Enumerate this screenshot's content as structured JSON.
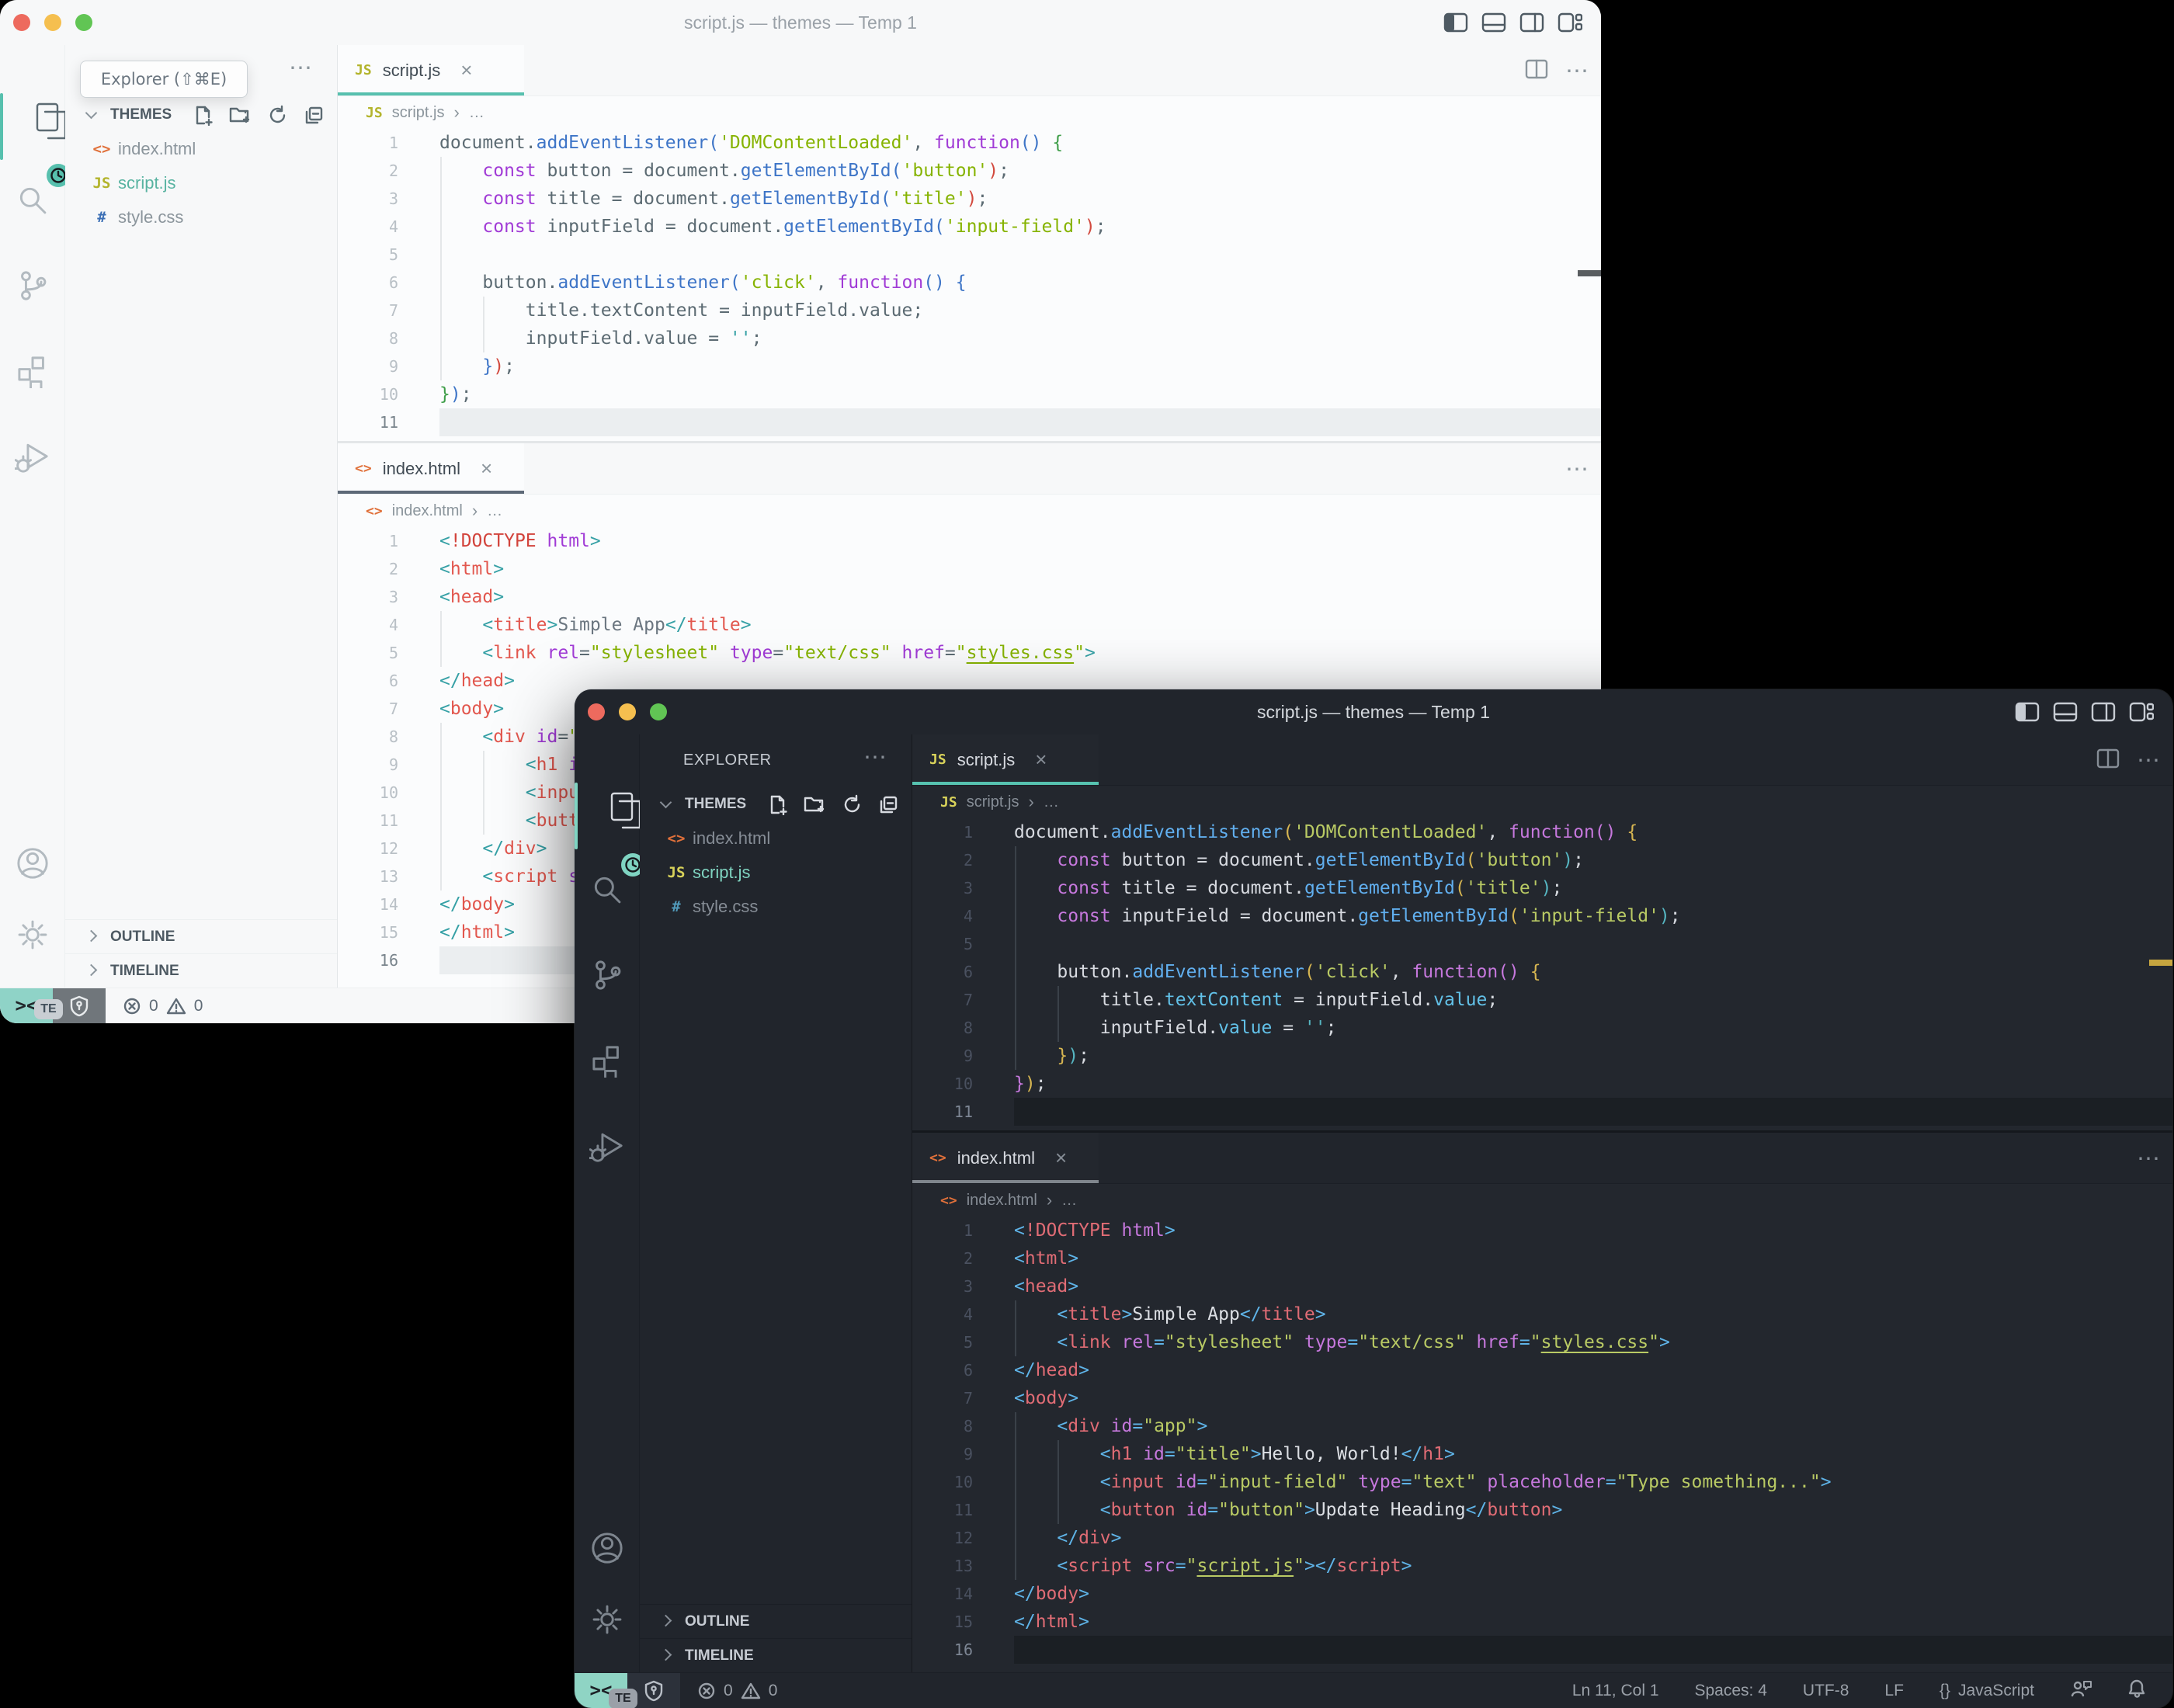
{
  "title": "script.js — themes — Temp 1",
  "tooltip": {
    "text": "Explorer (⇧⌘E)"
  },
  "sidebar": {
    "explorer": "EXPLORER",
    "section": "THEMES",
    "more": "⋯"
  },
  "files": [
    {
      "name": "index.html",
      "type": "html"
    },
    {
      "name": "script.js",
      "type": "js",
      "active": true
    },
    {
      "name": "style.css",
      "type": "css"
    }
  ],
  "tabs": {
    "script": "script.js",
    "html": "index.html",
    "close": "×"
  },
  "crumbs": {
    "script": "script.js",
    "html": "index.html",
    "sep": "›",
    "more": "…"
  },
  "panels": {
    "outline": "OUTLINE",
    "timeline": "TIMELINE"
  },
  "status": {
    "remote": "><",
    "errors": "0",
    "warnings": "0",
    "badge": "TE",
    "ln": "Ln 11, Col 1",
    "spaces": "Spaces: 4",
    "enc": "UTF-8",
    "eol": "LF",
    "braces": "{}",
    "lang": "JavaScript"
  },
  "accents": {
    "teal": "#56c2b0",
    "traffic_red": "#ed6a5e",
    "traffic_yellow": "#f5bf4f",
    "traffic_green": "#61c554",
    "ruler_gold": "#c6a53f",
    "html_icon": "#e0703a"
  },
  "code": {
    "script_js": [
      {
        "n": 1,
        "s": [
          [
            "document",
            "fg"
          ],
          [
            ".",
            "fg"
          ],
          [
            "addEventListener",
            "fn"
          ],
          [
            "(",
            "pr1"
          ],
          [
            "'DOMContentLoaded'",
            "str"
          ],
          [
            ", ",
            "fg"
          ],
          [
            "function",
            "kw"
          ],
          [
            "()",
            "pr2"
          ],
          [
            " ",
            "fg"
          ],
          [
            "{",
            "pr3"
          ]
        ]
      },
      {
        "n": 2,
        "s": [
          [
            "    ",
            "fg"
          ],
          [
            "const",
            "kw"
          ],
          [
            " button ",
            "fg"
          ],
          [
            "=",
            "fg"
          ],
          [
            " ",
            "fg"
          ],
          [
            "document",
            "fg"
          ],
          [
            ".",
            "fg"
          ],
          [
            "getElementById",
            "fn"
          ],
          [
            "(",
            "pr4"
          ],
          [
            "'button'",
            "str"
          ],
          [
            ")",
            "pr5"
          ],
          [
            ";",
            "fg"
          ]
        ]
      },
      {
        "n": 3,
        "s": [
          [
            "    ",
            "fg"
          ],
          [
            "const",
            "kw"
          ],
          [
            " title ",
            "fg"
          ],
          [
            "=",
            "fg"
          ],
          [
            " ",
            "fg"
          ],
          [
            "document",
            "fg"
          ],
          [
            ".",
            "fg"
          ],
          [
            "getElementById",
            "fn"
          ],
          [
            "(",
            "pr4"
          ],
          [
            "'title'",
            "str"
          ],
          [
            ")",
            "pr5"
          ],
          [
            ";",
            "fg"
          ]
        ]
      },
      {
        "n": 4,
        "s": [
          [
            "    ",
            "fg"
          ],
          [
            "const",
            "kw"
          ],
          [
            " inputField ",
            "fg"
          ],
          [
            "=",
            "fg"
          ],
          [
            " ",
            "fg"
          ],
          [
            "document",
            "fg"
          ],
          [
            ".",
            "fg"
          ],
          [
            "getElementById",
            "fn"
          ],
          [
            "(",
            "pr4"
          ],
          [
            "'input-field'",
            "str"
          ],
          [
            ")",
            "pr5"
          ],
          [
            ";",
            "fg"
          ]
        ]
      },
      {
        "n": 5,
        "s": [],
        "g": 1
      },
      {
        "n": 6,
        "s": [
          [
            "    ",
            "fg"
          ],
          [
            "button",
            "fg"
          ],
          [
            ".",
            "fg"
          ],
          [
            "addEventListener",
            "fn"
          ],
          [
            "(",
            "pr4"
          ],
          [
            "'click'",
            "str"
          ],
          [
            ", ",
            "fg"
          ],
          [
            "function",
            "kw"
          ],
          [
            "()",
            "pr2"
          ],
          [
            " ",
            "fg"
          ],
          [
            "{",
            "pr6"
          ]
        ]
      },
      {
        "n": 7,
        "s": [
          [
            "        ",
            "fg"
          ],
          [
            "title",
            "fg"
          ],
          [
            ".",
            "fg"
          ],
          [
            "textContent",
            "prop"
          ],
          [
            " = ",
            "fg"
          ],
          [
            "inputField",
            "fg"
          ],
          [
            ".",
            "fg"
          ],
          [
            "value",
            "prop"
          ],
          [
            ";",
            "fg"
          ]
        ]
      },
      {
        "n": 8,
        "s": [
          [
            "        ",
            "fg"
          ],
          [
            "inputField",
            "fg"
          ],
          [
            ".",
            "fg"
          ],
          [
            "value",
            "prop"
          ],
          [
            " = ",
            "fg"
          ],
          [
            "''",
            "str2"
          ],
          [
            ";",
            "fg"
          ]
        ]
      },
      {
        "n": 9,
        "s": [
          [
            "    ",
            "fg"
          ],
          [
            "}",
            "pr6"
          ],
          [
            ")",
            "pr7"
          ],
          [
            ";",
            "fg"
          ]
        ]
      },
      {
        "n": 10,
        "s": [
          [
            "}",
            "pr8"
          ],
          [
            ")",
            "pr9"
          ],
          [
            ";",
            "fg"
          ]
        ]
      },
      {
        "n": 11,
        "s": [],
        "hl": true
      }
    ],
    "index_html": [
      {
        "n": 1,
        "s": [
          [
            "<",
            "tp"
          ],
          [
            "!DOCTYPE",
            "doc"
          ],
          [
            " ",
            "fg"
          ],
          [
            "html",
            "kw"
          ],
          [
            ">",
            "tp"
          ]
        ]
      },
      {
        "n": 2,
        "s": [
          [
            "<",
            "tp"
          ],
          [
            "html",
            "tag"
          ],
          [
            ">",
            "tp"
          ]
        ]
      },
      {
        "n": 3,
        "s": [
          [
            "<",
            "tp"
          ],
          [
            "head",
            "tag"
          ],
          [
            ">",
            "tp"
          ]
        ]
      },
      {
        "n": 4,
        "s": [
          [
            "    ",
            "fg"
          ],
          [
            "<",
            "tp"
          ],
          [
            "title",
            "tag"
          ],
          [
            ">",
            "tp"
          ],
          [
            "Simple App",
            "txt"
          ],
          [
            "</",
            "tp"
          ],
          [
            "title",
            "tag"
          ],
          [
            ">",
            "tp"
          ]
        ]
      },
      {
        "n": 5,
        "s": [
          [
            "    ",
            "fg"
          ],
          [
            "<",
            "tp"
          ],
          [
            "link",
            "tag"
          ],
          [
            " ",
            "fg"
          ],
          [
            "rel",
            "attr"
          ],
          [
            "=",
            "eq"
          ],
          [
            "\"stylesheet\"",
            "str"
          ],
          [
            " ",
            "fg"
          ],
          [
            "type",
            "attr"
          ],
          [
            "=",
            "eq"
          ],
          [
            "\"text/css\"",
            "str"
          ],
          [
            " ",
            "fg"
          ],
          [
            "href",
            "attr"
          ],
          [
            "=",
            "eq"
          ],
          [
            "\"",
            "str"
          ],
          [
            "styles.css",
            "strU"
          ],
          [
            "\"",
            "str"
          ],
          [
            ">",
            "tp"
          ]
        ]
      },
      {
        "n": 6,
        "s": [
          [
            "</",
            "tp"
          ],
          [
            "head",
            "tag"
          ],
          [
            ">",
            "tp"
          ]
        ]
      },
      {
        "n": 7,
        "s": [
          [
            "<",
            "tp"
          ],
          [
            "body",
            "tag"
          ],
          [
            ">",
            "tp"
          ]
        ]
      },
      {
        "n": 8,
        "s": [
          [
            "    ",
            "fg"
          ],
          [
            "<",
            "tp"
          ],
          [
            "div",
            "tag"
          ],
          [
            " ",
            "fg"
          ],
          [
            "id",
            "attr"
          ],
          [
            "=",
            "eq"
          ],
          [
            "\"app\"",
            "str"
          ],
          [
            ">",
            "tp"
          ]
        ]
      },
      {
        "n": 9,
        "s": [
          [
            "        ",
            "fg"
          ],
          [
            "<",
            "tp"
          ],
          [
            "h1",
            "tag"
          ],
          [
            " ",
            "fg"
          ],
          [
            "id",
            "attr"
          ],
          [
            "=",
            "eq"
          ],
          [
            "\"title\"",
            "str"
          ],
          [
            ">",
            "tp"
          ],
          [
            "Hello, World!",
            "txt"
          ],
          [
            "</",
            "tp"
          ],
          [
            "h1",
            "tag"
          ],
          [
            ">",
            "tp"
          ]
        ]
      },
      {
        "n": 10,
        "s": [
          [
            "        ",
            "fg"
          ],
          [
            "<",
            "tp"
          ],
          [
            "input",
            "tag"
          ],
          [
            " ",
            "fg"
          ],
          [
            "id",
            "attr"
          ],
          [
            "=",
            "eq"
          ],
          [
            "\"input-field\"",
            "str"
          ],
          [
            " ",
            "fg"
          ],
          [
            "type",
            "attr"
          ],
          [
            "=",
            "eq"
          ],
          [
            "\"text\"",
            "str"
          ],
          [
            " ",
            "fg"
          ],
          [
            "placeholder",
            "attr"
          ],
          [
            "=",
            "eq"
          ],
          [
            "\"Type something...\"",
            "str"
          ],
          [
            ">",
            "tp"
          ]
        ]
      },
      {
        "n": 11,
        "s": [
          [
            "        ",
            "fg"
          ],
          [
            "<",
            "tp"
          ],
          [
            "button",
            "tag"
          ],
          [
            " ",
            "fg"
          ],
          [
            "id",
            "attr"
          ],
          [
            "=",
            "eq"
          ],
          [
            "\"button\"",
            "str"
          ],
          [
            ">",
            "tp"
          ],
          [
            "Update Heading",
            "txt"
          ],
          [
            "</",
            "tp"
          ],
          [
            "button",
            "tag"
          ],
          [
            ">",
            "tp"
          ]
        ]
      },
      {
        "n": 12,
        "s": [
          [
            "    ",
            "fg"
          ],
          [
            "</",
            "tp"
          ],
          [
            "div",
            "tag"
          ],
          [
            ">",
            "tp"
          ]
        ]
      },
      {
        "n": 13,
        "s": [
          [
            "    ",
            "fg"
          ],
          [
            "<",
            "tp"
          ],
          [
            "script",
            "tag"
          ],
          [
            " ",
            "fg"
          ],
          [
            "src",
            "attr"
          ],
          [
            "=",
            "eq"
          ],
          [
            "\"",
            "str"
          ],
          [
            "script.js",
            "strU"
          ],
          [
            "\"",
            "str"
          ],
          [
            ">",
            "tp"
          ],
          [
            "</",
            "tp"
          ],
          [
            "script",
            "tag"
          ],
          [
            ">",
            "tp"
          ]
        ]
      },
      {
        "n": 14,
        "s": [
          [
            "</",
            "tp"
          ],
          [
            "body",
            "tag"
          ],
          [
            ">",
            "tp"
          ]
        ]
      },
      {
        "n": 15,
        "s": [
          [
            "</",
            "tp"
          ],
          [
            "html",
            "tag"
          ],
          [
            ">",
            "tp"
          ]
        ]
      },
      {
        "n": 16,
        "s": [],
        "hl": true
      }
    ]
  },
  "themes": {
    "light": {
      "vars": {
        "--bg": "#fbfcfd",
        "--chrome": "#f7f8f9",
        "--border": "#e3e6e8",
        "--border2": "#edf0f1",
        "--fg": "#4e5a63",
        "--dim": "#8b959c",
        "--accent": "#57c0ae",
        "--uline2": "#5d6977",
        "--curline": "#ebeef0",
        "--guide": "#e4e7e9",
        "--num": "#b9c0c6",
        "--numact": "#79848c",
        "--title": "#9aa1a8",
        "--icon": "#b2bac0",
        "--iconact": "#5c6b73",
        "--remote-bg": "#8fd3c7",
        "--remote-fg": "#22282c",
        "--shield-bg": "#70767b",
        "--shield-fg": "#e8ebed",
        "--badge-bg": "#c9ced3",
        "--badge-fg": "#42505b",
        "--status-fg": "#5f6b76",
        "--tab-fg": "#414b54",
        "--ruler": "#595d60",
        "--indicator": "#57c0ae",
        "--jsicon": "#b3b42c",
        "--cssicon": "#3b6fb5",
        "--fileact": "#58b3a1"
      },
      "tokens": {
        "fg": {
          "c": "#5c6b73"
        },
        "fn": {
          "c": "#3e75c7"
        },
        "kw": {
          "c": "#a13bd6"
        },
        "str": {
          "c": "#86b300"
        },
        "str2": {
          "c": "#35a0a5"
        },
        "prop": {
          "c": "#5c6b73"
        },
        "pr1": {
          "c": "#3e75c7"
        },
        "pr2": {
          "c": "#3e75c7"
        },
        "pr3": {
          "c": "#3f9e49"
        },
        "pr4": {
          "c": "#3e75c7"
        },
        "pr5": {
          "c": "#d2493e"
        },
        "pr6": {
          "c": "#3e75c7"
        },
        "pr7": {
          "c": "#d2493e"
        },
        "pr8": {
          "c": "#3f9e49"
        },
        "pr9": {
          "c": "#3e75c7"
        },
        "tp": {
          "c": "#35a0a5"
        },
        "tag": {
          "c": "#e2574e"
        },
        "attr": {
          "c": "#a13bd6"
        },
        "eq": {
          "c": "#5c6b73"
        },
        "doc": {
          "c": "#d2433b"
        },
        "txt": {
          "c": "#6b7680"
        },
        "strU": {
          "c": "#86b300",
          "u": 1
        }
      }
    },
    "dark": {
      "vars": {
        "--bg": "#23272e",
        "--chrome": "#21252c",
        "--border": "#15181d",
        "--border2": "#1b1f26",
        "--fg": "#c7ccd3",
        "--dim": "#868d96",
        "--accent": "#56c2b0",
        "--uline2": "#80868d",
        "--curline": "#1b1f24",
        "--guide": "#3a4149",
        "--num": "#4a5160",
        "--numact": "#7d8694",
        "--title": "#d5d9de",
        "--icon": "#7e868f",
        "--iconact": "#d7dae0",
        "--remote-bg": "#8fd4c4",
        "--remote-fg": "#1d2126",
        "--shield-bg": "#2c313a",
        "--shield-fg": "#b8bec6",
        "--badge-bg": "#9aa0a8",
        "--badge-fg": "#22262d",
        "--status-fg": "#9aa0a8",
        "--tab-fg": "#d7dae0",
        "--ruler": "#c6a53f",
        "--indicator": "#7fd4c2",
        "--jsicon": "#d8d25a",
        "--cssicon": "#519aba",
        "--fileact": "#7fd3c0"
      },
      "tokens": {
        "fg": {
          "c": "#d7dae0"
        },
        "fn": {
          "c": "#61afef"
        },
        "kw": {
          "c": "#c678dd"
        },
        "str": {
          "c": "#b9ca64"
        },
        "str2": {
          "c": "#56b6c2"
        },
        "prop": {
          "c": "#62c1e8"
        },
        "pr1": {
          "c": "#d6b551"
        },
        "pr2": {
          "c": "#c678dd"
        },
        "pr3": {
          "c": "#d6b551"
        },
        "pr4": {
          "c": "#d6b551"
        },
        "pr5": {
          "c": "#56b6c2"
        },
        "pr6": {
          "c": "#d6b551"
        },
        "pr7": {
          "c": "#56b6c2"
        },
        "pr8": {
          "c": "#c678dd"
        },
        "pr9": {
          "c": "#d6b551"
        },
        "tp": {
          "c": "#5fb4e8"
        },
        "tag": {
          "c": "#e06c75"
        },
        "attr": {
          "c": "#c678dd"
        },
        "eq": {
          "c": "#5fb4e8"
        },
        "doc": {
          "c": "#e06c75"
        },
        "txt": {
          "c": "#dcdfe4"
        },
        "strU": {
          "c": "#b9ca64",
          "u": 1
        }
      }
    }
  }
}
